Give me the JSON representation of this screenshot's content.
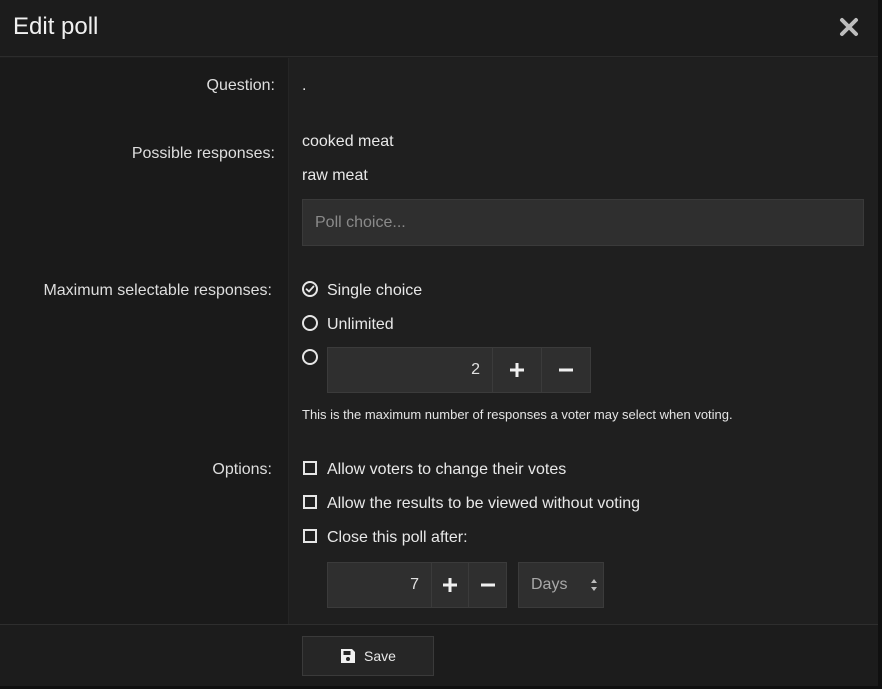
{
  "dialog": {
    "title": "Edit poll",
    "close_icon": "close-icon"
  },
  "form": {
    "question": {
      "label": "Question:",
      "value": "."
    },
    "responses": {
      "label": "Possible responses:",
      "items": [
        "cooked meat",
        "raw meat"
      ],
      "placeholder": "Poll choice..."
    },
    "max_responses": {
      "label": "Maximum selectable responses:",
      "options": [
        {
          "label": "Single choice",
          "selected": true
        },
        {
          "label": "Unlimited",
          "selected": false
        },
        {
          "label": "",
          "selected": false
        }
      ],
      "custom_value": "2",
      "plus_icon": "plus-icon",
      "minus_icon": "minus-icon",
      "hint": "This is the maximum number of responses a voter may select when voting."
    },
    "options": {
      "label": "Options:",
      "items": [
        {
          "label": "Allow voters to change their votes",
          "checked": false
        },
        {
          "label": "Allow the results to be viewed without voting",
          "checked": false
        },
        {
          "label": "Close this poll after:",
          "checked": false
        }
      ],
      "close_after_value": "7",
      "close_after_unit": "Days"
    }
  },
  "footer": {
    "save_label": "Save",
    "save_icon": "save-icon"
  }
}
